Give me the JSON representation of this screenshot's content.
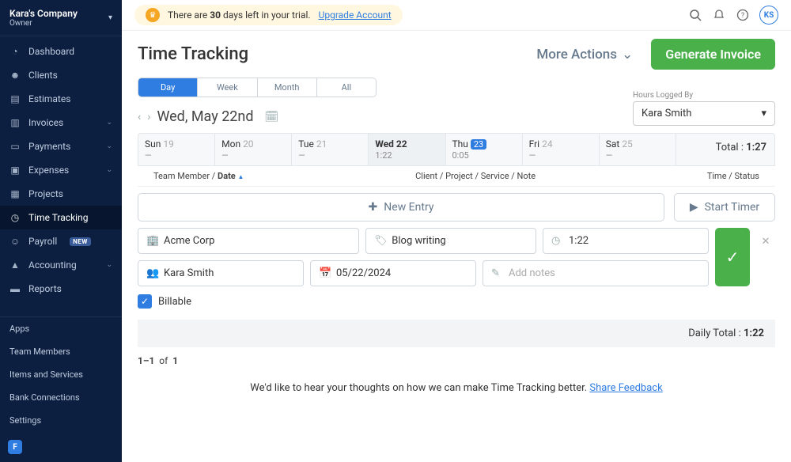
{
  "company": {
    "name": "Kara's Company",
    "role": "Owner"
  },
  "trial": {
    "prefix": "There are ",
    "days": "30",
    "suffix": " days left in your trial.",
    "upgrade": "Upgrade Account"
  },
  "avatar": "KS",
  "sidebar": {
    "items": [
      {
        "label": "Dashboard"
      },
      {
        "label": "Clients"
      },
      {
        "label": "Estimates"
      },
      {
        "label": "Invoices"
      },
      {
        "label": "Payments"
      },
      {
        "label": "Expenses"
      },
      {
        "label": "Projects"
      },
      {
        "label": "Time Tracking"
      },
      {
        "label": "Payroll",
        "badge": "NEW"
      },
      {
        "label": "Accounting"
      },
      {
        "label": "Reports"
      }
    ],
    "sub": [
      "Apps",
      "Team Members",
      "Items and Services",
      "Bank Connections",
      "Settings"
    ]
  },
  "page": {
    "title": "Time Tracking",
    "more": "More Actions",
    "generate": "Generate Invoice"
  },
  "seg": [
    "Day",
    "Week",
    "Month",
    "All"
  ],
  "hours_logged": {
    "label": "Hours Logged By",
    "value": "Kara Smith"
  },
  "date_display": "Wed, May 22nd",
  "week": [
    {
      "d": "Sun",
      "n": "19",
      "v": "—"
    },
    {
      "d": "Mon",
      "n": "20",
      "v": "—"
    },
    {
      "d": "Tue",
      "n": "21",
      "v": "—"
    },
    {
      "d": "Wed",
      "n": "22",
      "v": "1:22"
    },
    {
      "d": "Thu",
      "n": "23",
      "v": "0:05"
    },
    {
      "d": "Fri",
      "n": "24",
      "v": "—"
    },
    {
      "d": "Sat",
      "n": "25",
      "v": "—"
    }
  ],
  "total": {
    "label": "Total :",
    "value": "1:27"
  },
  "colhead": {
    "left1": "Team Member",
    "left2": "Date",
    "mid": "Client / Project / Service / Note",
    "right": "Time / Status"
  },
  "actions": {
    "new_entry": "New Entry",
    "start_timer": "Start Timer"
  },
  "form": {
    "client": "Acme Corp",
    "project": "Blog writing",
    "time": "1:22",
    "user": "Kara Smith",
    "date": "05/22/2024",
    "notes_placeholder": "Add notes"
  },
  "billable_label": "Billable",
  "daily_total": {
    "label": "Daily Total :",
    "value": "1:22"
  },
  "count": {
    "range": "1–1",
    "of": "of",
    "total": "1"
  },
  "feedback": {
    "text": "We'd like to hear your thoughts on how we can make Time Tracking better.",
    "link": "Share Feedback"
  }
}
